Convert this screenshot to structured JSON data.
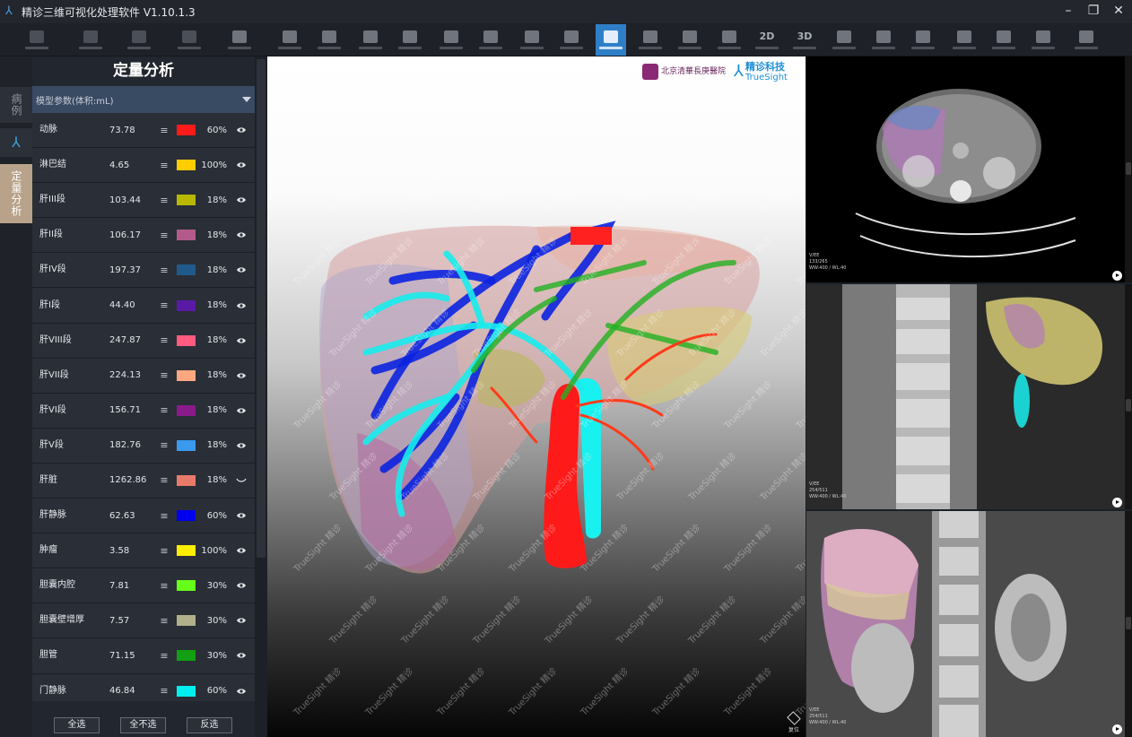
{
  "window": {
    "title": "精诊三维可视化处理软件 V1.10.1.3"
  },
  "toolbar": {
    "items": [
      "",
      "",
      "",
      "",
      "",
      "",
      "",
      "",
      "",
      "",
      "",
      "",
      "",
      "",
      "",
      "",
      "",
      "2D",
      "3D",
      "",
      "",
      "",
      "",
      "",
      "",
      "",
      "",
      ""
    ],
    "active_index": 13
  },
  "sidetabs": {
    "case_label": "病例",
    "quant_label": "定量分析"
  },
  "panel": {
    "title": "定量分析",
    "dropdown_label": "模型参数(体积:mL)",
    "rows": [
      {
        "name": "动脉",
        "volume": "73.78",
        "color": "#ff1a1a",
        "opacity": "60%",
        "visible": true
      },
      {
        "name": "淋巴结",
        "volume": "4.65",
        "color": "#ffcc00",
        "opacity": "100%",
        "visible": true
      },
      {
        "name": "肝III段",
        "volume": "103.44",
        "color": "#b8b800",
        "opacity": "18%",
        "visible": true
      },
      {
        "name": "肝II段",
        "volume": "106.17",
        "color": "#b35a8a",
        "opacity": "18%",
        "visible": true
      },
      {
        "name": "肝IV段",
        "volume": "197.37",
        "color": "#1f5a8a",
        "opacity": "18%",
        "visible": true
      },
      {
        "name": "肝I段",
        "volume": "44.40",
        "color": "#5a1aa8",
        "opacity": "18%",
        "visible": true
      },
      {
        "name": "肝VIII段",
        "volume": "247.87",
        "color": "#ff5a80",
        "opacity": "18%",
        "visible": true
      },
      {
        "name": "肝VII段",
        "volume": "224.13",
        "color": "#ffa880",
        "opacity": "18%",
        "visible": true
      },
      {
        "name": "肝VI段",
        "volume": "156.71",
        "color": "#8a1a8a",
        "opacity": "18%",
        "visible": true
      },
      {
        "name": "肝V段",
        "volume": "182.76",
        "color": "#3a9aee",
        "opacity": "18%",
        "visible": true
      },
      {
        "name": "肝脏",
        "volume": "1262.86",
        "color": "#e87a6a",
        "opacity": "18%",
        "visible": false
      },
      {
        "name": "肝静脉",
        "volume": "62.63",
        "color": "#0000ee",
        "opacity": "60%",
        "visible": true
      },
      {
        "name": "肿瘤",
        "volume": "3.58",
        "color": "#ffee00",
        "opacity": "100%",
        "visible": true
      },
      {
        "name": "胆囊内腔",
        "volume": "7.81",
        "color": "#66ff1a",
        "opacity": "30%",
        "visible": true
      },
      {
        "name": "胆囊壁增厚",
        "volume": "7.57",
        "color": "#b0b08a",
        "opacity": "30%",
        "visible": true
      },
      {
        "name": "胆管",
        "volume": "71.15",
        "color": "#12a012",
        "opacity": "30%",
        "visible": true
      },
      {
        "name": "门静脉",
        "volume": "46.84",
        "color": "#00f0f0",
        "opacity": "60%",
        "visible": true
      }
    ],
    "buttons": {
      "select_all": "全选",
      "select_none": "全不选",
      "invert": "反选"
    }
  },
  "view3d": {
    "hospital_logo_text": "北京清華長庚醫院",
    "brand_cn": "精诊科技",
    "brand_en": "TrueSight",
    "watermark": "TrueSight 精诊",
    "reset_label": "复位"
  },
  "ct": {
    "axial": {
      "line1": "V/EE",
      "line2": "133/265",
      "line3": "WW:400 / WL:40"
    },
    "sagittal": {
      "line1": "V/EE",
      "line2": "254/511",
      "line3": "WW:400 / WL:40"
    },
    "coronal": {
      "line1": "V/EE",
      "line2": "254/511",
      "line3": "WW:400 / WL:40"
    }
  }
}
